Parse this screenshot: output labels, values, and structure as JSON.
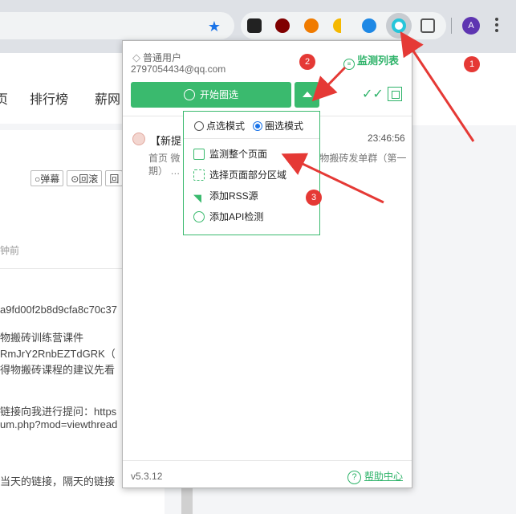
{
  "browser": {
    "account_initial": "A",
    "extensions": [
      {
        "icon": "robot-extension-icon",
        "color": "#222222"
      },
      {
        "icon": "ublock-icon",
        "color": "#800000"
      },
      {
        "icon": "orange-extension-icon",
        "color": "#f07b00"
      },
      {
        "icon": "yellow-extension-icon",
        "color": "#f5b800"
      },
      {
        "icon": "pulse-extension-icon",
        "color": "#1e88e5"
      },
      {
        "icon": "monitor-extension-icon",
        "color": "#26c6da"
      }
    ]
  },
  "page": {
    "nav": [
      "页",
      "排行榜",
      "薪网"
    ],
    "buttons": [
      "○弹幕",
      "⊙回滚",
      "回"
    ],
    "lines": [
      "钟前",
      "a9fd00f2b8d9cfa8c70c37",
      "物搬砖训练营课件",
      "RmJrY2RnbEZTdGRK（",
      "得物搬砖课程的建议先看",
      "链接向我进行提问：https",
      "um.php?mod=viewthread",
      "当天的链接，隔天的链接"
    ]
  },
  "popup": {
    "user_type": "普通用户",
    "email": "2797054434@qq.com",
    "monitor_list": "监测列表",
    "start_button": "开始圈选",
    "modes": [
      "点选模式",
      "圈选模式"
    ],
    "selected_mode": "圈选模式",
    "menu": [
      "监测整个页面",
      "选择页面部分区域",
      "添加RSS源",
      "添加API检测"
    ],
    "item": {
      "title": "【新提",
      "time": "23:46:56",
      "body": "首页 微 … 薪网大事记 1 发新文 已加 … 物搬砖发单群（第一期） … 文 听安 到手363 听…"
    },
    "version": "v5.3.12",
    "help": "帮助中心"
  },
  "annotations": {
    "badges": [
      "1",
      "2",
      "3"
    ],
    "color": "#e53935"
  }
}
